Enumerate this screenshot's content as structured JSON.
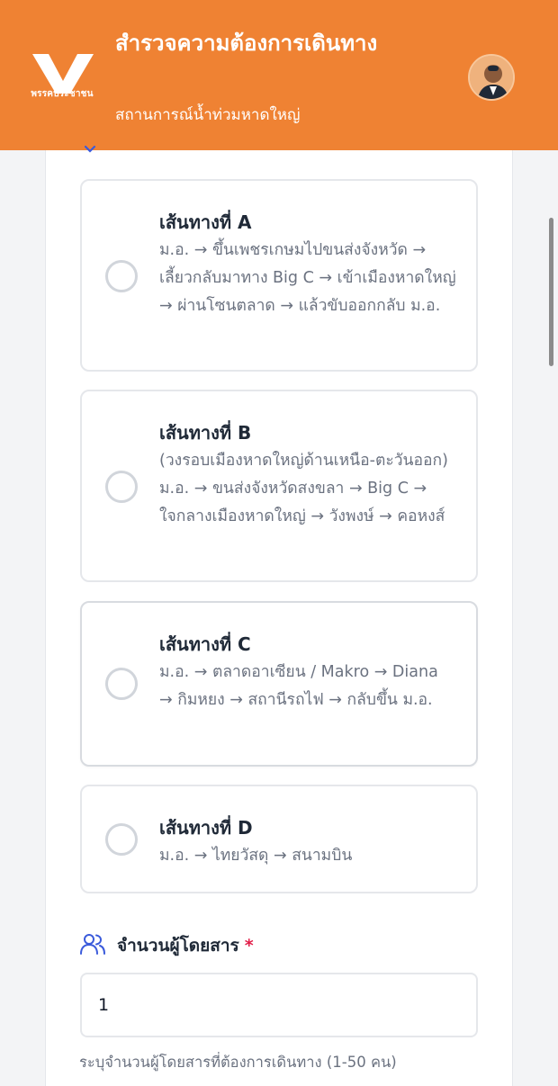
{
  "header": {
    "logo_caption": "พรรคประชาชน",
    "title": "สำรวจความต้องการเดินทาง",
    "subtitle": "สถานการณ์น้ำท่วมหาดใหญ่"
  },
  "routes": [
    {
      "title": "เส้นทางที่ A",
      "description": "ม.อ. → ขึ้นเพชรเกษมไปขนส่งจังหวัด → เลี้ยวกลับมาทาง Big C → เข้าเมืองหาดใหญ่ → ผ่านโซนตลาด → แล้วขับออกกลับ ม.อ.",
      "selected": false
    },
    {
      "title": "เส้นทางที่ B",
      "description": "(วงรอบเมืองหาดใหญ่ด้านเหนือ-ตะวันออก) ม.อ. → ขนส่งจังหวัดสงขลา → Big C → ใจกลางเมืองหาดใหญ่ → วังพงษ์ → คอหงส์",
      "selected": false
    },
    {
      "title": "เส้นทางที่ C",
      "description": "ม.อ. → ตลาดอาเซียน / Makro → Diana → กิมหยง → สถานีรถไฟ → กลับขึ้น ม.อ.",
      "selected": false
    },
    {
      "title": "เส้นทางที่ D",
      "description": "ม.อ. → ไทยวัสดุ → สนามบิน",
      "selected": false
    }
  ],
  "passengers": {
    "label": "จำนวนผู้โดยสาร",
    "required_mark": "*",
    "value": "1",
    "help": "ระบุจำนวนผู้โดยสารที่ต้องการเดินทาง (1-50 คน)"
  },
  "colors": {
    "header_bg": "#ef8233",
    "accent_blue": "#3b5bdb",
    "required_red": "#e11d48"
  },
  "icons": {
    "logo": "party-logo-icon",
    "avatar": "user-avatar",
    "passengers": "users-icon",
    "chevron": "chevron-down-icon"
  }
}
